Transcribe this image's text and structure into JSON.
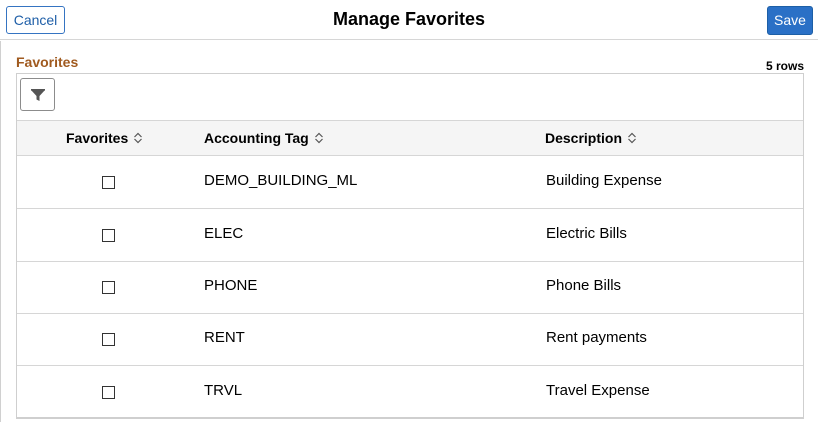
{
  "header": {
    "title": "Manage Favorites",
    "cancel_label": "Cancel",
    "save_label": "Save"
  },
  "grid": {
    "title": "Favorites",
    "row_count": "5 rows",
    "filter_icon": "filter-icon",
    "columns": [
      "Favorites",
      "Accounting Tag",
      "Description"
    ],
    "rows": [
      {
        "favorite": false,
        "tag": "DEMO_BUILDING_ML",
        "description": "Building Expense"
      },
      {
        "favorite": false,
        "tag": "ELEC",
        "description": "Electric Bills"
      },
      {
        "favorite": false,
        "tag": "PHONE",
        "description": "Phone Bills"
      },
      {
        "favorite": false,
        "tag": "RENT",
        "description": "Rent payments"
      },
      {
        "favorite": false,
        "tag": "TRVL",
        "description": "Travel Expense"
      }
    ]
  },
  "colors": {
    "accent": "#2a70c6",
    "section_title": "#a05a1f"
  }
}
